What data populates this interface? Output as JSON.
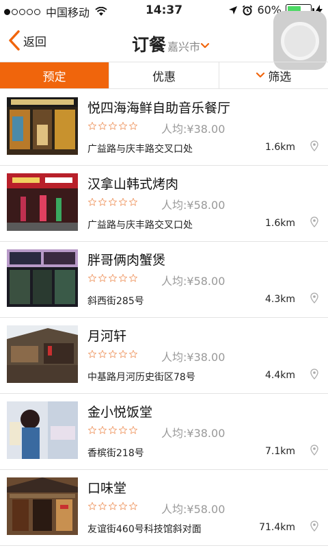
{
  "status_bar": {
    "carrier": "中国移动",
    "time": "14:37",
    "battery": "60%",
    "battery_level": 0.6,
    "signal_bars_filled": 1,
    "signal_bars_total": 5
  },
  "nav": {
    "back_label": "返回",
    "title": "订餐",
    "city": "嘉兴市"
  },
  "tabs": [
    {
      "label": "预定",
      "active": true
    },
    {
      "label": "优惠",
      "active": false
    },
    {
      "label": "筛选",
      "active": false
    }
  ],
  "restaurants": [
    {
      "name": "悦四海海鲜自助音乐餐厅",
      "rating": 0,
      "avg_price": "人均:¥38.00",
      "address": "广益路与庆丰路交叉口处",
      "distance": "1.6km"
    },
    {
      "name": "汉拿山韩式烤肉",
      "rating": 0,
      "avg_price": "人均:¥58.00",
      "address": "广益路与庆丰路交叉口处",
      "distance": "1.6km"
    },
    {
      "name": "胖哥俩肉蟹煲",
      "rating": 0,
      "avg_price": "人均:¥58.00",
      "address": "斜西街285号",
      "distance": "4.3km"
    },
    {
      "name": "月河轩",
      "rating": 0,
      "avg_price": "人均:¥38.00",
      "address": "中基路月河历史街区78号",
      "distance": "4.4km"
    },
    {
      "name": "金小悦饭堂",
      "rating": 0,
      "avg_price": "人均:¥38.00",
      "address": "香槟街218号",
      "distance": "7.1km"
    },
    {
      "name": "口味堂",
      "rating": 0,
      "avg_price": "人均:¥58.00",
      "address": "友谊街460号科技馆斜对面",
      "distance": "71.4km"
    }
  ],
  "colors": {
    "accent": "#f0650c",
    "star_outline": "#f0a070",
    "muted_text": "#999999",
    "divider": "#e3e3e3"
  },
  "icons": {
    "back": "chevron-left-icon",
    "city_dropdown": "chevron-down-icon",
    "filter_dropdown": "chevron-down-icon",
    "location": "map-pin-icon",
    "star": "star-outline-icon"
  }
}
